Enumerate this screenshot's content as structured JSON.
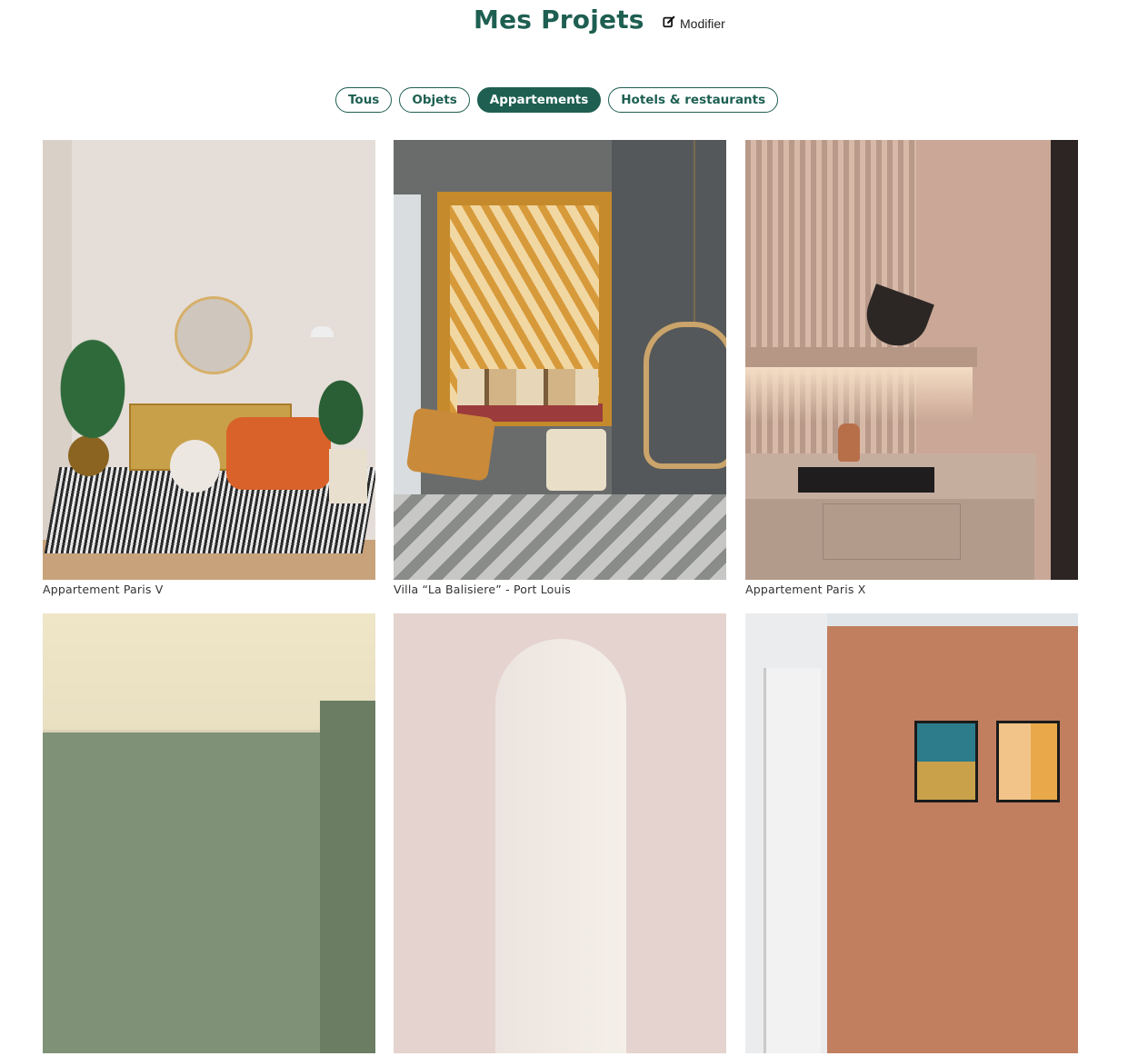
{
  "header": {
    "title": "Mes Projets",
    "edit_label": "Modifier"
  },
  "filters": [
    {
      "label": "Tous",
      "active": false
    },
    {
      "label": "Objets",
      "active": false
    },
    {
      "label": "Appartements",
      "active": true
    },
    {
      "label": "Hotels & restaurants",
      "active": false
    }
  ],
  "projects": [
    {
      "caption": "Appartement Paris V"
    },
    {
      "caption": "Villa “La Balisiere” - Port Louis"
    },
    {
      "caption": "Appartement Paris X"
    },
    {
      "caption": ""
    },
    {
      "caption": ""
    },
    {
      "caption": ""
    }
  ],
  "colors": {
    "accent": "#1e5f52"
  }
}
